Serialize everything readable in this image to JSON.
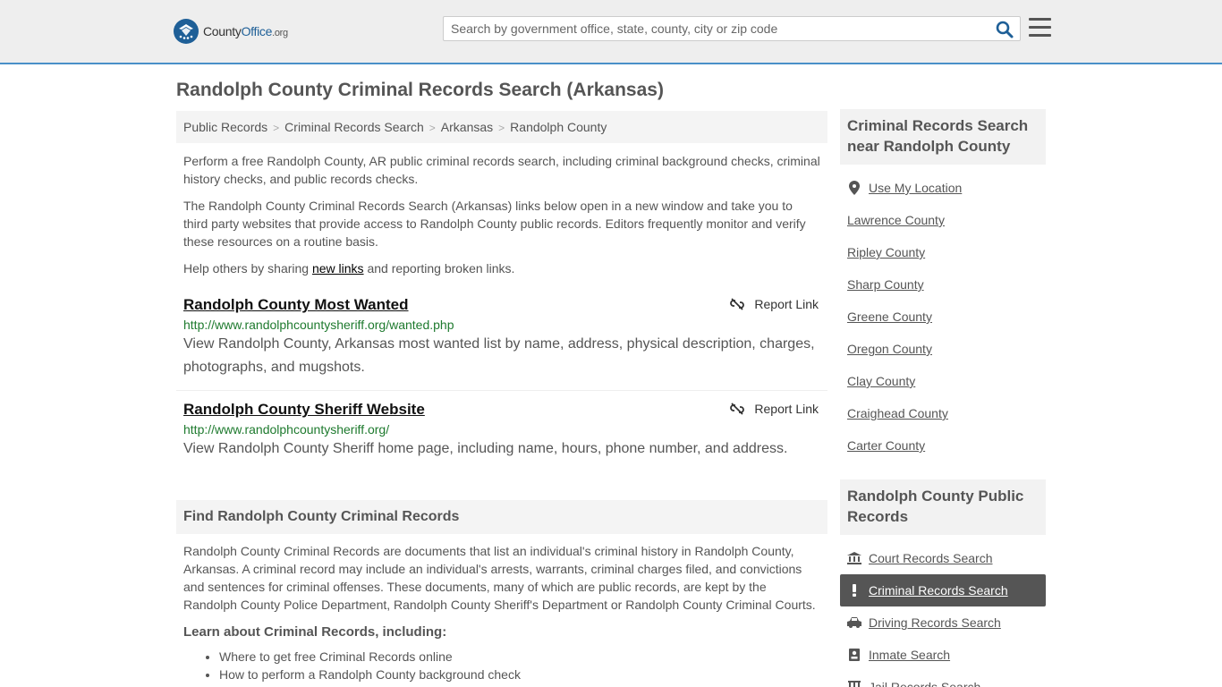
{
  "header": {
    "logo_prefix": "County",
    "logo_bold": "Office",
    "logo_suffix": ".org",
    "search_placeholder": "Search by government office, state, county, city or zip code"
  },
  "page_title": "Randolph County Criminal Records Search (Arkansas)",
  "breadcrumb": [
    "Public Records",
    "Criminal Records Search",
    "Arkansas",
    "Randolph County"
  ],
  "intro": {
    "p1": "Perform a free Randolph County, AR public criminal records search, including criminal background checks, criminal history checks, and public records checks.",
    "p2": "The Randolph County Criminal Records Search (Arkansas) links below open in a new window and take you to third party websites that provide access to Randolph County public records. Editors frequently monitor and verify these resources on a routine basis.",
    "p3_before": "Help others by sharing ",
    "p3_link": "new links",
    "p3_after": " and reporting broken links."
  },
  "results": [
    {
      "title": "Randolph County Most Wanted",
      "url": "http://www.randolphcountysheriff.org/wanted.php",
      "desc": "View Randolph County, Arkansas most wanted list by name, address, physical description, charges, photographs, and mugshots.",
      "report": "Report Link"
    },
    {
      "title": "Randolph County Sheriff Website",
      "url": "http://www.randolphcountysheriff.org/",
      "desc": "View Randolph County Sheriff home page, including name, hours, phone number, and address.",
      "report": "Report Link"
    }
  ],
  "find": {
    "heading": "Find Randolph County Criminal Records",
    "body": "Randolph County Criminal Records are documents that list an individual's criminal history in Randolph County, Arkansas. A criminal record may include an individual's arrests, warrants, criminal charges filed, and convictions and sentences for criminal offenses. These documents, many of which are public records, are kept by the Randolph County Police Department, Randolph County Sheriff's Department or Randolph County Criminal Courts.",
    "learn": "Learn about Criminal Records, including:",
    "list": [
      "Where to get free Criminal Records online",
      "How to perform a Randolph County background check"
    ]
  },
  "sidebar": {
    "near_heading": "Criminal Records Search near Randolph County",
    "use_location": "Use My Location",
    "near_items": [
      "Lawrence County",
      "Ripley County",
      "Sharp County",
      "Greene County",
      "Oregon County",
      "Clay County",
      "Craighead County",
      "Carter County"
    ],
    "public_heading": "Randolph County Public Records",
    "public_items": [
      "Court Records Search",
      "Criminal Records Search",
      "Driving Records Search",
      "Inmate Search",
      "Jail Records Search"
    ]
  },
  "colors": {
    "accent": "#4a90c8",
    "logo_blue": "#1e5f97",
    "url_green": "#1e7a2e",
    "active_bg": "#555555"
  }
}
